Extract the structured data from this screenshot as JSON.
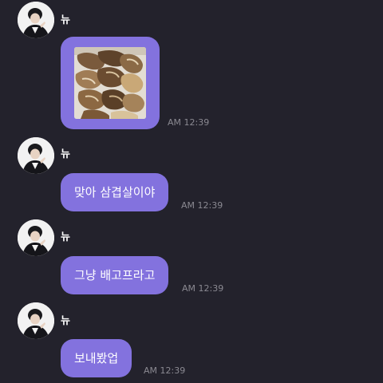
{
  "chat": {
    "messages": [
      {
        "sender": "뉴",
        "type": "photo",
        "text": "",
        "time": "AM 12:39"
      },
      {
        "sender": "뉴",
        "type": "text",
        "text": "맞아 삼겹살이야",
        "time": "AM 12:39"
      },
      {
        "sender": "뉴",
        "type": "text",
        "text": "그냥 배고프라고",
        "time": "AM 12:39"
      },
      {
        "sender": "뉴",
        "type": "text",
        "text": "보내봤업",
        "time": "AM 12:39"
      }
    ]
  },
  "colors": {
    "background": "#23222c",
    "bubble": "#8372de",
    "timestamp": "#8a8991"
  },
  "icons": {
    "avatar": "profile-avatar",
    "photo": "pork-belly-photo"
  }
}
